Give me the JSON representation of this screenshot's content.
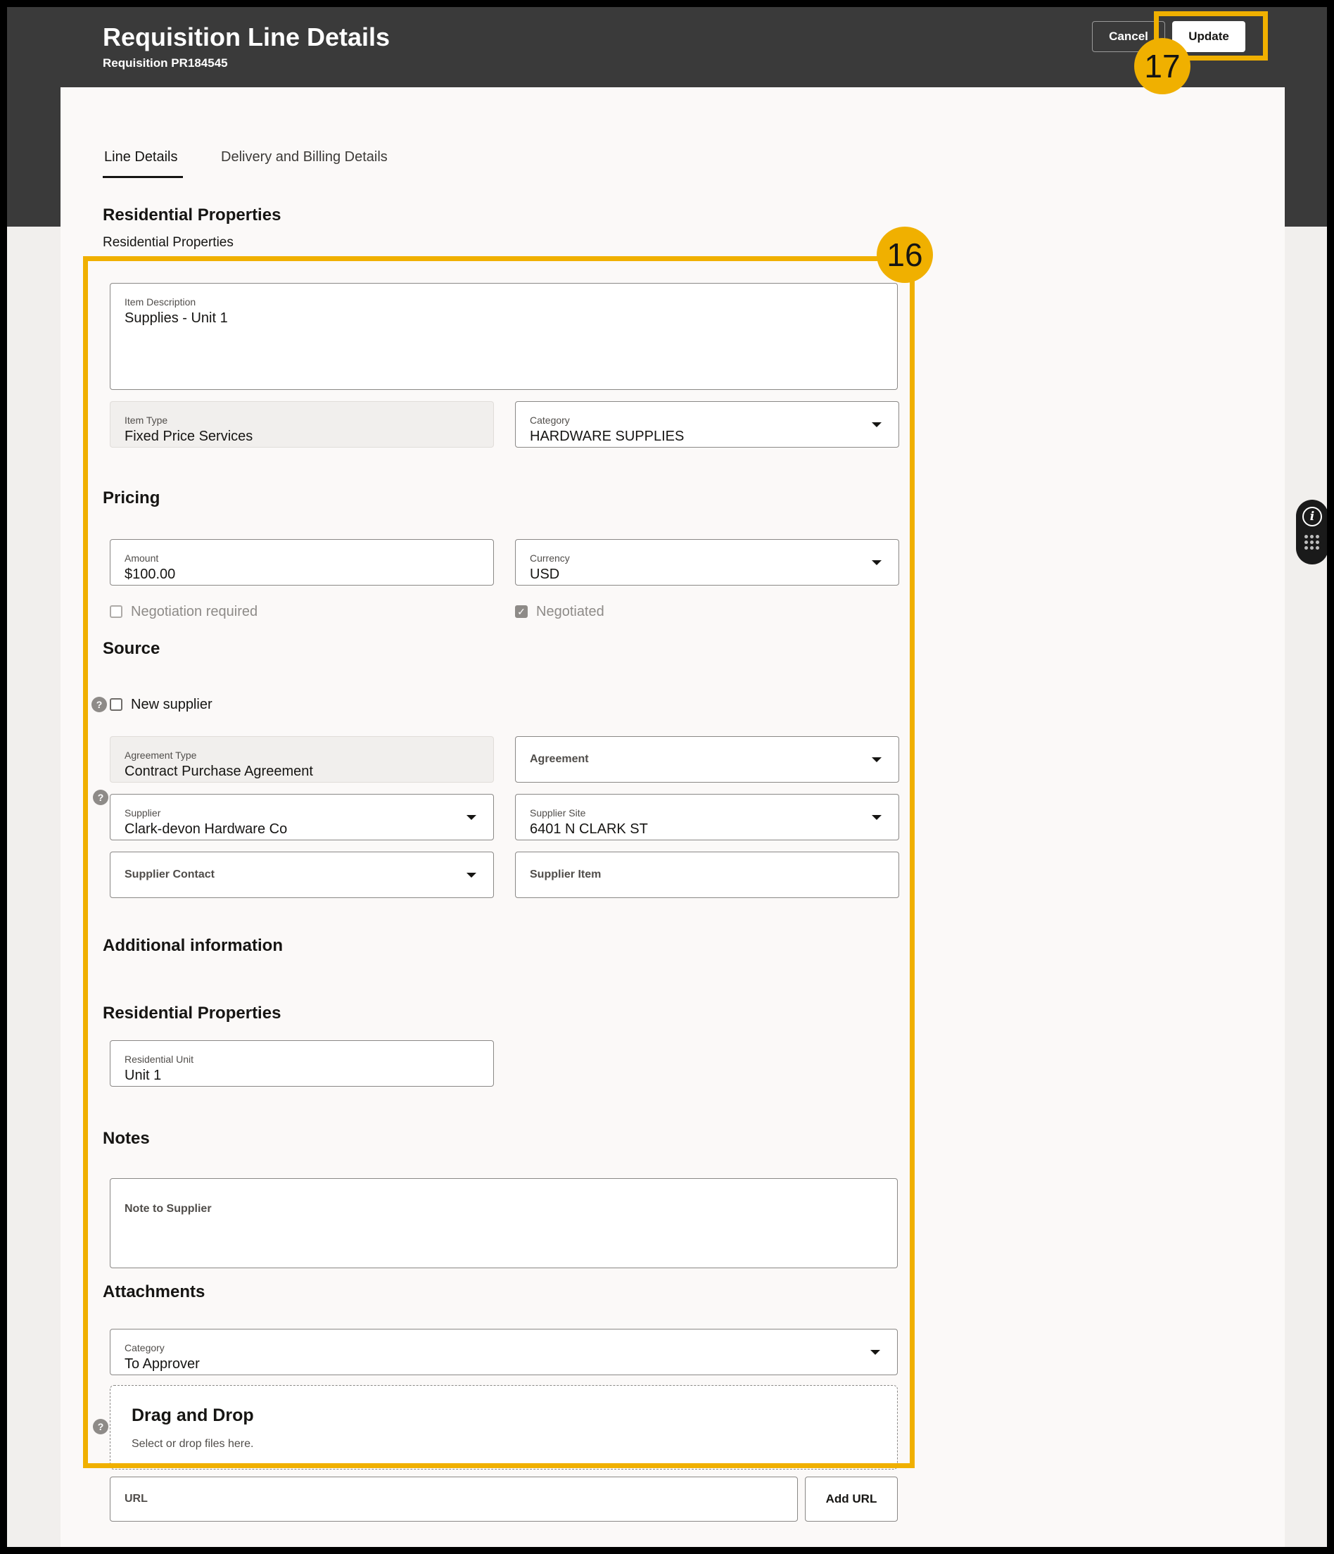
{
  "header": {
    "title": "Requisition Line Details",
    "subtitle": "Requisition PR184545",
    "cancel_label": "Cancel",
    "update_label": "Update"
  },
  "tabs": [
    {
      "label": "Line Details",
      "selected": true
    },
    {
      "label": "Delivery and Billing Details",
      "selected": false
    }
  ],
  "top_section": {
    "title": "Residential Properties",
    "subtitle": "Residential Properties"
  },
  "item": {
    "description_label": "Item Description",
    "description_value": "Supplies - Unit 1",
    "type_label": "Item Type",
    "type_value": "Fixed Price Services",
    "category_label": "Category",
    "category_value": "HARDWARE SUPPLIES"
  },
  "pricing": {
    "title": "Pricing",
    "amount_label": "Amount",
    "amount_value": "$100.00",
    "currency_label": "Currency",
    "currency_value": "USD",
    "negotiation_required_label": "Negotiation required",
    "negotiation_required": false,
    "negotiated_label": "Negotiated",
    "negotiated": true
  },
  "source": {
    "title": "Source",
    "new_supplier_label": "New supplier",
    "new_supplier": false,
    "agreement_type_label": "Agreement Type",
    "agreement_type_value": "Contract Purchase Agreement",
    "agreement_label": "Agreement",
    "supplier_label": "Supplier",
    "supplier_value": "Clark-devon Hardware Co",
    "supplier_site_label": "Supplier Site",
    "supplier_site_value": "6401 N CLARK ST",
    "supplier_contact_label": "Supplier Contact",
    "supplier_item_label": "Supplier Item"
  },
  "additional": {
    "title": "Additional information",
    "sub_title": "Residential Properties",
    "residential_unit_label": "Residential Unit",
    "residential_unit_value": "Unit 1"
  },
  "notes": {
    "title": "Notes",
    "note_label": "Note to Supplier"
  },
  "attachments": {
    "title": "Attachments",
    "category_label": "Category",
    "category_value": "To Approver",
    "drop_title": "Drag and Drop",
    "drop_subtitle": "Select or drop files here.",
    "url_label": "URL",
    "add_url_label": "Add URL"
  },
  "callouts": {
    "badge_16": "16",
    "badge_17": "17",
    "color": "#f0b000"
  },
  "help_glyph": "?",
  "info_glyph": "i"
}
